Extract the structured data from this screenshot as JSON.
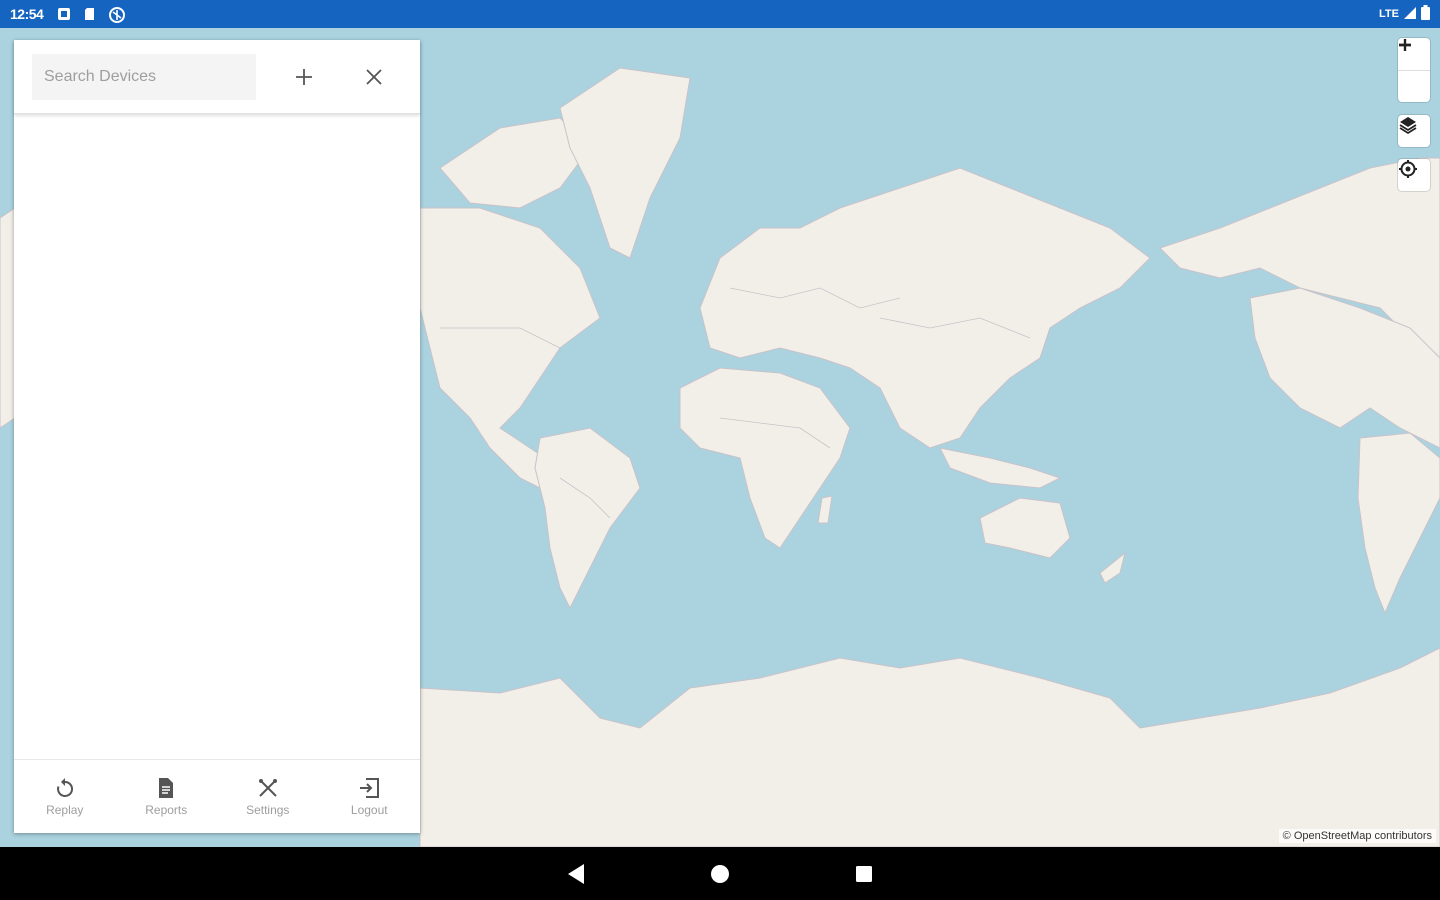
{
  "status_bar": {
    "time": "12:54",
    "network": "LTE",
    "left_icons": [
      "notification-icon",
      "sim-icon",
      "accessibility-icon"
    ],
    "right_icons": [
      "signal-icon",
      "battery-icon"
    ]
  },
  "panel": {
    "search": {
      "placeholder": "Search Devices",
      "value": ""
    },
    "add_icon": "plus-icon",
    "close_icon": "close-icon",
    "devices": [],
    "bottom_nav": [
      {
        "label": "Replay",
        "icon": "replay-icon"
      },
      {
        "label": "Reports",
        "icon": "description-icon"
      },
      {
        "label": "Settings",
        "icon": "settings-icon"
      },
      {
        "label": "Logout",
        "icon": "logout-icon"
      }
    ]
  },
  "map": {
    "attribution": "© OpenStreetMap contributors",
    "controls": [
      "zoom-in-icon",
      "zoom-out-icon",
      "layers-icon",
      "locate-icon"
    ],
    "colors": {
      "water": "#aad3df",
      "land": "#f2efe9",
      "border": "#c9c2c9"
    }
  },
  "android_nav": [
    "back-icon",
    "home-icon",
    "recents-icon"
  ],
  "colors": {
    "status_bar": "#1565c0",
    "panel": "#ffffff",
    "nav_bar": "#000000"
  }
}
